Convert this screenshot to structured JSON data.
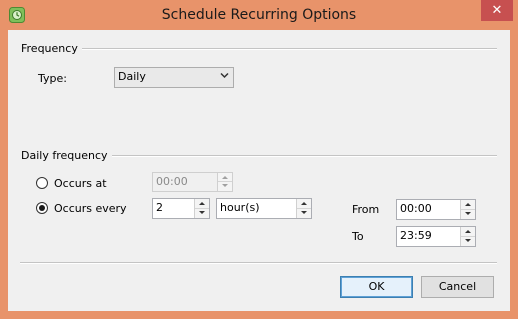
{
  "window": {
    "title": "Schedule Recurring Options",
    "close_glyph": "✕",
    "accent": "#e8936a",
    "app_icon": "app-icon"
  },
  "frequency": {
    "group_label": "Frequency",
    "type_label": "Type:",
    "type_value": "Daily"
  },
  "daily": {
    "group_label": "Daily frequency",
    "occurs_at_label": "Occurs at",
    "occurs_at_value": "00:00",
    "occurs_every_label": "Occurs every",
    "occurs_every_value": "2",
    "unit_value": "hour(s)",
    "selected": "occurs_every",
    "from_label": "From",
    "from_value": "00:00",
    "to_label": "To",
    "to_value": "23:59"
  },
  "buttons": {
    "ok": "OK",
    "cancel": "Cancel"
  }
}
